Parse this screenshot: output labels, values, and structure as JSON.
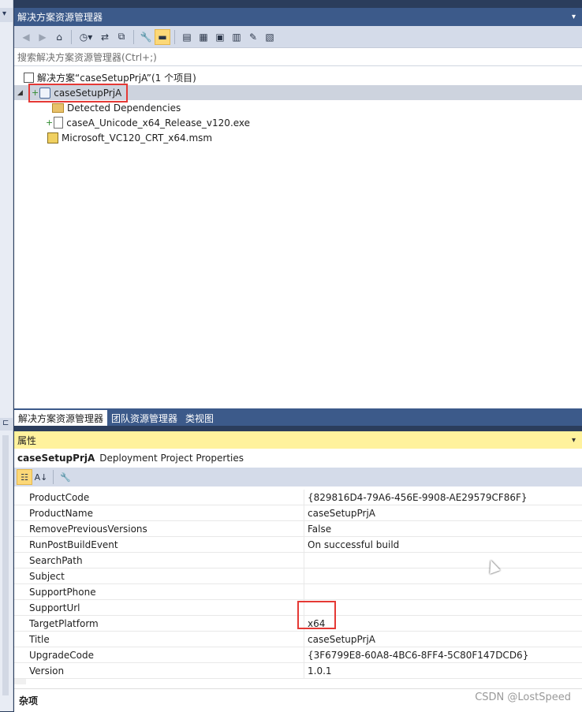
{
  "solution_explorer": {
    "title": "解决方案资源管理器",
    "dropdown_glyph": "▾",
    "search_placeholder": "搜索解决方案资源管理器(Ctrl+;)",
    "toolbar_icons": [
      "back-icon",
      "forward-icon",
      "home-icon",
      "history-icon",
      "sync-icon",
      "collapse-all-icon",
      "properties-icon",
      "preview-icon",
      "file-system-editor-icon",
      "registry-editor-icon",
      "file-types-editor-icon",
      "user-interface-editor-icon",
      "custom-actions-editor-icon",
      "launch-conditions-editor-icon"
    ],
    "tree": {
      "solution": "解决方案“caseSetupPrjA”(1 个项目)",
      "project": "caseSetupPrjA",
      "items": [
        "Detected Dependencies",
        "caseA_Unicode_x64_Release_v120.exe",
        "Microsoft_VC120_CRT_x64.msm"
      ]
    }
  },
  "tabs": [
    "解决方案资源管理器",
    "团队资源管理器",
    "类视图"
  ],
  "properties": {
    "title": "属性",
    "dropdown_glyph": "▾",
    "object_name": "caseSetupPrjA",
    "object_type": "Deployment Project Properties",
    "rows": [
      {
        "name": "ProductCode",
        "value": "{829816D4-79A6-456E-9908-AE29579CF86F}"
      },
      {
        "name": "ProductName",
        "value": "caseSetupPrjA"
      },
      {
        "name": "RemovePreviousVersions",
        "value": "False"
      },
      {
        "name": "RunPostBuildEvent",
        "value": "On successful build"
      },
      {
        "name": "SearchPath",
        "value": ""
      },
      {
        "name": "Subject",
        "value": ""
      },
      {
        "name": "SupportPhone",
        "value": ""
      },
      {
        "name": "SupportUrl",
        "value": ""
      },
      {
        "name": "TargetPlatform",
        "value": "x64"
      },
      {
        "name": "Title",
        "value": "caseSetupPrjA"
      },
      {
        "name": "UpgradeCode",
        "value": "{3F6799E8-60A8-4BC6-8FF4-5C80F147DCD6}"
      },
      {
        "name": "Version",
        "value": "1.0.1"
      }
    ],
    "footer": "杂项"
  },
  "watermark": "CSDN @LostSpeed",
  "colors": {
    "title_bar": "#3c5a8a",
    "properties_title": "#fff29d",
    "highlight_box": "#e53935",
    "toolbar": "#d4dbe9"
  }
}
